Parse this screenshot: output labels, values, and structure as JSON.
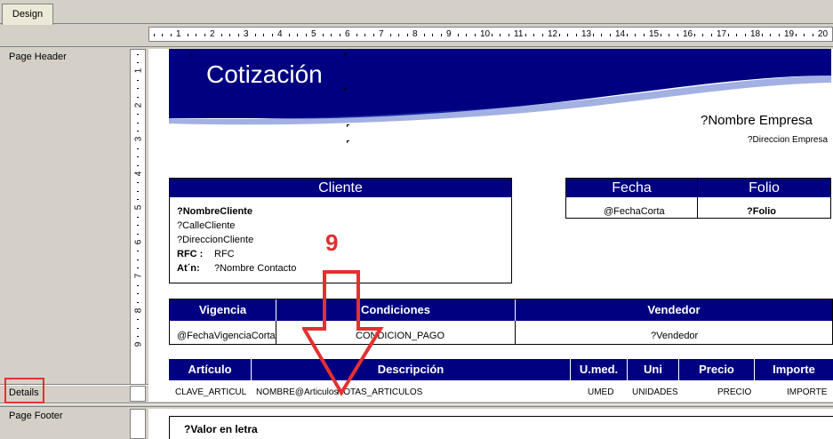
{
  "tabs": {
    "design": "Design"
  },
  "sections": {
    "page_header": "Page Header",
    "details": "Details",
    "page_footer": "Page Footer"
  },
  "ruler": {
    "h_marks": [
      "1",
      "2",
      "3",
      "4",
      "5",
      "6",
      "7",
      "8",
      "9",
      "10",
      "11",
      "12",
      "13",
      "14",
      "15",
      "16",
      "17",
      "18",
      "19",
      "20"
    ],
    "v_marks": [
      "1",
      "2",
      "3",
      "4",
      "5",
      "6",
      "7",
      "8",
      "9"
    ]
  },
  "header": {
    "title": "Cotización",
    "company_name": "?Nombre Empresa",
    "company_address": "?Direccion Empresa"
  },
  "cliente": {
    "heading": "Cliente",
    "name": "?NombreCliente",
    "street": "?CalleCliente",
    "address": "?DireccionCliente",
    "rfc_label": "RFC :",
    "rfc_value": "RFC",
    "attn_label": "At´n:",
    "contact": "?Nombre Contacto"
  },
  "fecha": {
    "heading": "Fecha",
    "value": "@FechaCorta"
  },
  "folio": {
    "heading": "Folio",
    "value": "?Folio"
  },
  "vigencia": {
    "heading": "Vigencia",
    "value": "@FechaVigenciaCorta"
  },
  "condiciones": {
    "heading": "Condiciones",
    "value": "CONDICION_PAGO"
  },
  "vendedor": {
    "heading": "Vendedor",
    "value": "?Vendedor"
  },
  "columns": {
    "articulo": "Artículo",
    "descripcion": "Descripción",
    "umed": "U.med.",
    "uni": "Uni",
    "precio": "Precio",
    "importe": "Importe"
  },
  "details": {
    "clave": "CLAVE_ARTICUL",
    "nombre": "NOMBRE@Articulos",
    "notas": "NOTAS_ARTICULOS",
    "umed": "UMED",
    "unidades": "UNIDADES",
    "precio": "PRECIO",
    "importe": "IMPORTE"
  },
  "footer": {
    "valor_letra": "?Valor en letra"
  },
  "annotation": {
    "step_number": "9",
    "color": "#e03030"
  },
  "colors": {
    "accent": "#000080",
    "background": "#d4d0c8"
  }
}
